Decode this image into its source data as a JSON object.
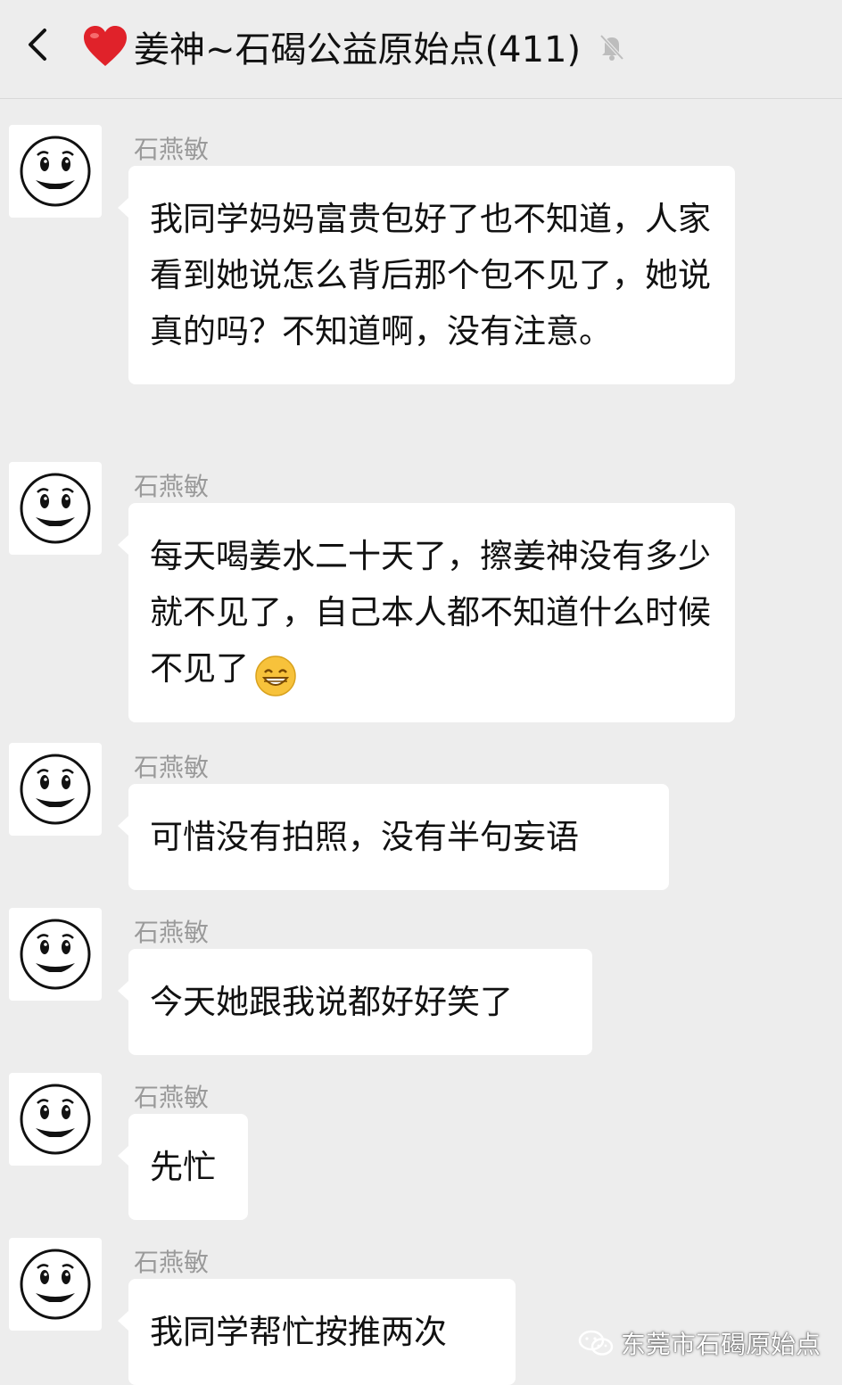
{
  "header": {
    "title": "姜神~石碣公益原始点(411)",
    "heart_icon": "red-heart",
    "mute_icon": "bell-muted-icon"
  },
  "messages": [
    {
      "sender": "石燕敏",
      "text": "我同学妈妈富贵包好了也不知道，人家看到她说怎么背后那个包不见了，她说真的吗？不知道啊，没有注意。"
    },
    {
      "sender": "石燕敏",
      "text": "每天喝姜水二十天了，擦姜神没有多少就不见了，自己本人都不知道什么时候不见了",
      "emoji": "grinning-face"
    },
    {
      "sender": "石燕敏",
      "text": "可惜没有拍照，没有半句妄语"
    },
    {
      "sender": "石燕敏",
      "text": "今天她跟我说都好好笑了"
    },
    {
      "sender": "石燕敏",
      "text": "先忙"
    },
    {
      "sender": "石燕敏",
      "text": "我同学帮忙按推两次"
    }
  ],
  "watermark": {
    "text": "东莞市石碣原始点",
    "icon": "wechat-icon"
  },
  "colors": {
    "background": "#ededed",
    "bubble": "#ffffff",
    "sender": "#9a9a9a",
    "heart": "#e0222a"
  }
}
